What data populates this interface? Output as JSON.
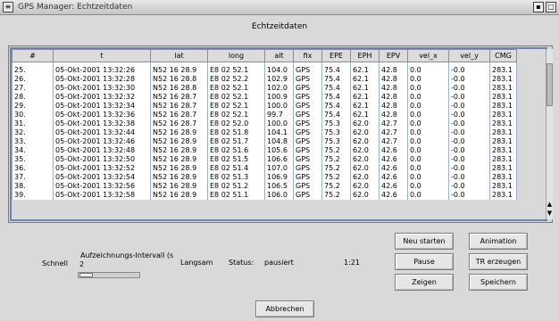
{
  "window": {
    "title": "GPS Manager: Echtzeitdaten"
  },
  "heading": "Echtzeitdaten",
  "table": {
    "columns": [
      "#",
      "t",
      "lat",
      "long",
      "alt",
      "fix",
      "EPE",
      "EPH",
      "EPV",
      "vel_x",
      "vel_y",
      "CMG"
    ],
    "rows": [
      [
        "25.",
        "05-Okt-2001 13:32:26",
        "N52 16 28.9",
        "E8 02 52.1",
        "104.0",
        "GPS",
        "75.4",
        "62.1",
        "42.8",
        "0.0",
        "-0.0",
        "283.1"
      ],
      [
        "26.",
        "05-Okt-2001 13:32:28",
        "N52 16 28.8",
        "E8 02 52.2",
        "102.9",
        "GPS",
        "75.4",
        "62.1",
        "42.8",
        "0.0",
        "-0.0",
        "283.1"
      ],
      [
        "27.",
        "05-Okt-2001 13:32:30",
        "N52 16 28.8",
        "E8 02 52.1",
        "102.0",
        "GPS",
        "75.4",
        "62.1",
        "42.8",
        "0.0",
        "-0.0",
        "283.1"
      ],
      [
        "28.",
        "05-Okt-2001 13:32:32",
        "N52 16 28.7",
        "E8 02 52.1",
        "100.9",
        "GPS",
        "75.4",
        "62.1",
        "42.8",
        "0.0",
        "-0.0",
        "283.1"
      ],
      [
        "29.",
        "05-Okt-2001 13:32:34",
        "N52 16 28.7",
        "E8 02 52.1",
        "100.0",
        "GPS",
        "75.4",
        "62.1",
        "42.8",
        "0.0",
        "-0.0",
        "283.1"
      ],
      [
        "30.",
        "05-Okt-2001 13:32:36",
        "N52 16 28.7",
        "E8 02 52.1",
        "99.7",
        "GPS",
        "75.4",
        "62.1",
        "42.8",
        "0.0",
        "-0.0",
        "283.1"
      ],
      [
        "31.",
        "05-Okt-2001 13:32:38",
        "N52 16 28.7",
        "E8 02 52.0",
        "100.0",
        "GPS",
        "75.3",
        "62.0",
        "42.7",
        "0.0",
        "-0.0",
        "283.1"
      ],
      [
        "32.",
        "05-Okt-2001 13:32:44",
        "N52 16 28.9",
        "E8 02 51.8",
        "104.1",
        "GPS",
        "75.3",
        "62.0",
        "42.7",
        "0.0",
        "-0.0",
        "283.1"
      ],
      [
        "33.",
        "05-Okt-2001 13:32:46",
        "N52 16 28.9",
        "E8 02 51.7",
        "104.8",
        "GPS",
        "75.3",
        "62.0",
        "42.7",
        "0.0",
        "-0.0",
        "283.1"
      ],
      [
        "34.",
        "05-Okt-2001 13:32:48",
        "N52 16 28.9",
        "E8 02 51.6",
        "105.6",
        "GPS",
        "75.2",
        "62.0",
        "42.6",
        "0.0",
        "-0.0",
        "283.1"
      ],
      [
        "35.",
        "05-Okt-2001 13:32:50",
        "N52 16 28.9",
        "E8 02 51.5",
        "106.6",
        "GPS",
        "75.2",
        "62.0",
        "42.6",
        "0.0",
        "-0.0",
        "283.1"
      ],
      [
        "36.",
        "05-Okt-2001 13:32:52",
        "N52 16 28.9",
        "E8 02 51.4",
        "107.0",
        "GPS",
        "75.2",
        "62.0",
        "42.6",
        "0.0",
        "-0.0",
        "283.1"
      ],
      [
        "37.",
        "05-Okt-2001 13:32:54",
        "N52 16 28.9",
        "E8 02 51.3",
        "106.9",
        "GPS",
        "75.2",
        "62.0",
        "42.6",
        "0.0",
        "-0.0",
        "283.1"
      ],
      [
        "38.",
        "05-Okt-2001 13:32:56",
        "N52 16 28.9",
        "E8 02 51.2",
        "106.5",
        "GPS",
        "75.2",
        "62.0",
        "42.6",
        "0.0",
        "-0.0",
        "283.1"
      ],
      [
        "39.",
        "05-Okt-2001 13:32:58",
        "N52 16 28.9",
        "E8 02 51.1",
        "106.0",
        "GPS",
        "75.2",
        "62.0",
        "42.6",
        "0.0",
        "-0.0",
        "283.1"
      ]
    ]
  },
  "controls": {
    "fast_label": "Schnell",
    "interval_label": "Aufzeichnungs-Intervall (s",
    "interval_value": "2",
    "slow_label": "Langsam",
    "status_label": "Status:",
    "status_value": "pausiert",
    "counter": "1:21"
  },
  "buttons": {
    "restart": "Neu starten",
    "animation": "Animation",
    "pause": "Pause",
    "create_tr": "TR erzeugen",
    "show": "Zeigen",
    "save": "Speichern",
    "cancel": "Abbrechen"
  },
  "icons": {
    "window_menu": "window-menu-icon",
    "iconify": "iconify-icon",
    "maximize": "maximize-icon",
    "scroll_up": "arrow-up-icon",
    "scroll_down": "arrow-down-icon"
  }
}
